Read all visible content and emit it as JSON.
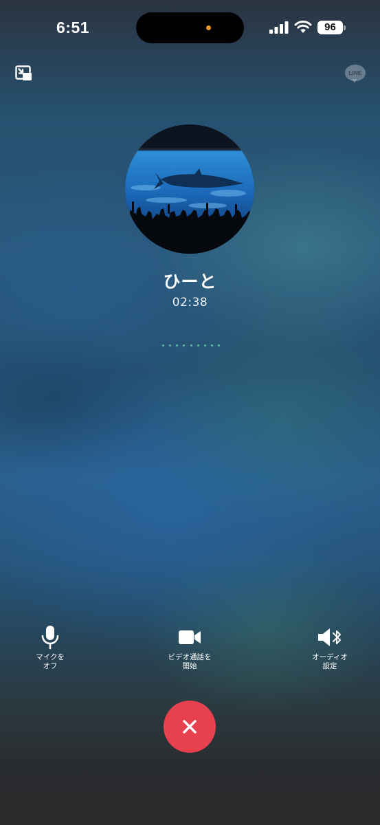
{
  "status_bar": {
    "time": "6:51",
    "battery_level": "96",
    "camera_indicator_color": "#f2902a"
  },
  "top_bar": {
    "minimize_icon": "picture-in-picture-minimize-icon",
    "app_logo_text": "LINE"
  },
  "caller": {
    "avatar": "aquarium-whale-shark-photo",
    "name": "ひーと",
    "duration": "02:38"
  },
  "controls": {
    "mic": {
      "label": "マイクを\nオフ",
      "icon": "microphone-icon"
    },
    "video": {
      "label": "ビデオ通話を\n開始",
      "icon": "video-camera-icon"
    },
    "audio": {
      "label": "オーディオ\n設定",
      "icon": "speaker-bluetooth-icon"
    }
  },
  "end_call": {
    "icon": "close-x-icon",
    "color": "#e8414e"
  },
  "colors": {
    "accent_green": "#6fd39b",
    "end_call_red": "#e8414e"
  }
}
